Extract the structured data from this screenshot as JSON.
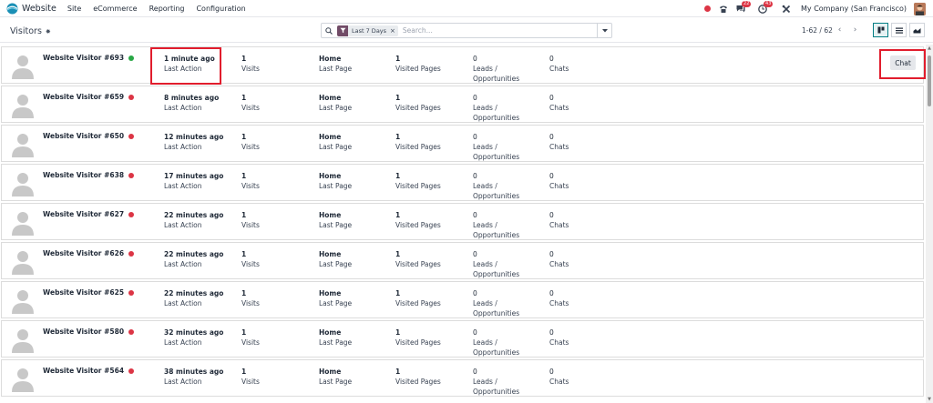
{
  "navbar": {
    "app_name": "Website",
    "menu": [
      "Site",
      "eCommerce",
      "Reporting",
      "Configuration"
    ],
    "messages_badge": "22",
    "activities_badge": "43",
    "company": "My Company (San Francisco)"
  },
  "control_panel": {
    "breadcrumb": "Visitors",
    "facet": "Last 7 Days",
    "search_placeholder": "Search...",
    "pager": "1-62 / 62"
  },
  "labels": {
    "last_action": "Last Action",
    "visits": "Visits",
    "last_page": "Last Page",
    "visited_pages": "Visited Pages",
    "leads_1": "Leads /",
    "leads_2": "Opportunities",
    "chats": "Chats",
    "chat_button": "Chat"
  },
  "colors": {
    "online": "#28a745",
    "offline": "#dc3545",
    "brand": "#714b67",
    "highlight": "#e11d2d"
  },
  "visitors": [
    {
      "name": "Website Visitor #693",
      "status": "online",
      "last_action": "1 minute ago",
      "visits": "1",
      "last_page": "Home",
      "visited_pages": "1",
      "leads": "0",
      "chats": "0",
      "chat_button": true
    },
    {
      "name": "Website Visitor #659",
      "status": "offline",
      "last_action": "8 minutes ago",
      "visits": "1",
      "last_page": "Home",
      "visited_pages": "1",
      "leads": "0",
      "chats": "0"
    },
    {
      "name": "Website Visitor #650",
      "status": "offline",
      "last_action": "12 minutes ago",
      "visits": "1",
      "last_page": "Home",
      "visited_pages": "1",
      "leads": "0",
      "chats": "0"
    },
    {
      "name": "Website Visitor #638",
      "status": "offline",
      "last_action": "17 minutes ago",
      "visits": "1",
      "last_page": "Home",
      "visited_pages": "1",
      "leads": "0",
      "chats": "0"
    },
    {
      "name": "Website Visitor #627",
      "status": "offline",
      "last_action": "22 minutes ago",
      "visits": "1",
      "last_page": "Home",
      "visited_pages": "1",
      "leads": "0",
      "chats": "0"
    },
    {
      "name": "Website Visitor #626",
      "status": "offline",
      "last_action": "22 minutes ago",
      "visits": "1",
      "last_page": "Home",
      "visited_pages": "1",
      "leads": "0",
      "chats": "0"
    },
    {
      "name": "Website Visitor #625",
      "status": "offline",
      "last_action": "22 minutes ago",
      "visits": "1",
      "last_page": "Home",
      "visited_pages": "1",
      "leads": "0",
      "chats": "0"
    },
    {
      "name": "Website Visitor #580",
      "status": "offline",
      "last_action": "32 minutes ago",
      "visits": "1",
      "last_page": "Home",
      "visited_pages": "1",
      "leads": "0",
      "chats": "0"
    },
    {
      "name": "Website Visitor #564",
      "status": "offline",
      "last_action": "38 minutes ago",
      "visits": "1",
      "last_page": "Home",
      "visited_pages": "1",
      "leads": "0",
      "chats": "0"
    }
  ]
}
